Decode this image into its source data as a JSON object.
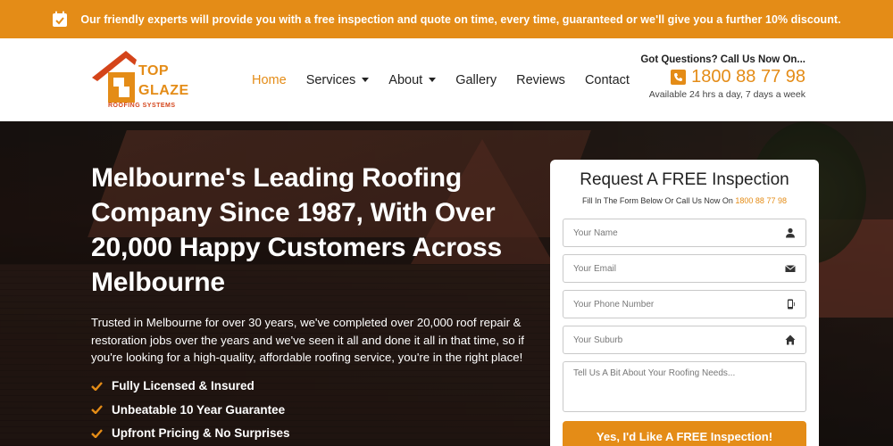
{
  "topbar": {
    "message": "Our friendly experts will provide you with a free inspection and quote on time, every time, guaranteed or we'll give you a further 10% discount.",
    "icon": "calendar-check-icon"
  },
  "logo": {
    "line1": "TOP",
    "line2": "GLAZE",
    "line3": "ROOFING SYSTEMS"
  },
  "nav": {
    "items": [
      {
        "label": "Home",
        "active": true
      },
      {
        "label": "Services",
        "dropdown": true
      },
      {
        "label": "About",
        "dropdown": true
      },
      {
        "label": "Gallery"
      },
      {
        "label": "Reviews"
      },
      {
        "label": "Contact"
      }
    ]
  },
  "contact": {
    "question": "Got Questions? Call Us Now On...",
    "phone": "1800 88 77 98",
    "availability": "Available 24 hrs a day, 7 days a week"
  },
  "hero": {
    "title": "Melbourne's Leading Roofing Company Since 1987, With Over 20,000 Happy Customers Across Melbourne",
    "paragraph": "Trusted in Melbourne for over 30 years, we've completed over 20,000 roof repair & restoration jobs over the years and we've seen it all and done it all in that time, so if you're looking for a high-quality, affordable roofing service, you're in the right place!",
    "checks": [
      "Fully Licensed & Insured",
      "Unbeatable 10 Year Guarantee",
      "Upfront Pricing & No Surprises"
    ]
  },
  "form": {
    "title": "Request A FREE Inspection",
    "subtitle": "Fill In The Form Below Or Call Us Now On",
    "subtitle_phone": "1800 88 77 98",
    "fields": [
      {
        "placeholder": "Your Name",
        "icon": "user-icon"
      },
      {
        "placeholder": "Your Email",
        "icon": "envelope-icon"
      },
      {
        "placeholder": "Your Phone Number",
        "icon": "mobile-phone-icon"
      },
      {
        "placeholder": "Your Suburb",
        "icon": "home-icon"
      }
    ],
    "message_placeholder": "Tell Us A Bit About Your Roofing Needs...",
    "submit_label": "Yes, I'd Like A FREE Inspection!"
  },
  "colors": {
    "accent": "#e48c17",
    "logo_red": "#d4441a"
  }
}
